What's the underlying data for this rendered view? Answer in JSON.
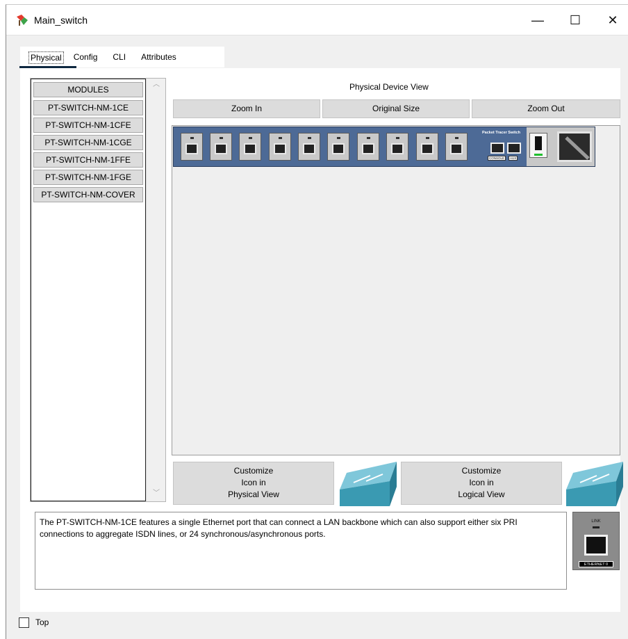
{
  "window": {
    "title": "Main_switch",
    "min_glyph": "—",
    "max_glyph": "☐",
    "close_glyph": "✕"
  },
  "tabs": [
    {
      "label": "Physical",
      "active": true
    },
    {
      "label": "Config"
    },
    {
      "label": "CLI"
    },
    {
      "label": "Attributes"
    }
  ],
  "modules": {
    "header": "MODULES",
    "items": [
      "PT-SWITCH-NM-1CE",
      "PT-SWITCH-NM-1CFE",
      "PT-SWITCH-NM-1CGE",
      "PT-SWITCH-NM-1FFE",
      "PT-SWITCH-NM-1FGE",
      "PT-SWITCH-NM-COVER"
    ]
  },
  "device_view": {
    "label": "Physical Device View",
    "zoom_in": "Zoom In",
    "original_size": "Original Size",
    "zoom_out": "Zoom Out",
    "device_brand": "Packet Tracer Switch",
    "console_label": "CONSOLE",
    "aux_label": "AUX"
  },
  "customize": {
    "physical": [
      "Customize",
      "Icon in",
      "Physical View"
    ],
    "logical": [
      "Customize",
      "Icon in",
      "Logical View"
    ]
  },
  "description": "The PT-SWITCH-NM-1CE features a single Ethernet port that can connect a LAN backbone which can also support either six PRI connections to aggregate ISDN lines, or 24 synchronous/asynchronous ports.",
  "module_image": {
    "link_label": "LINK",
    "port_label": "ETHERNET 0"
  },
  "footer": {
    "top_label": "Top",
    "top_checked": false
  },
  "colors": {
    "accent": "#0e2840",
    "device_blue": "#4d6a96",
    "switch_teal": "#3a9ab2"
  }
}
